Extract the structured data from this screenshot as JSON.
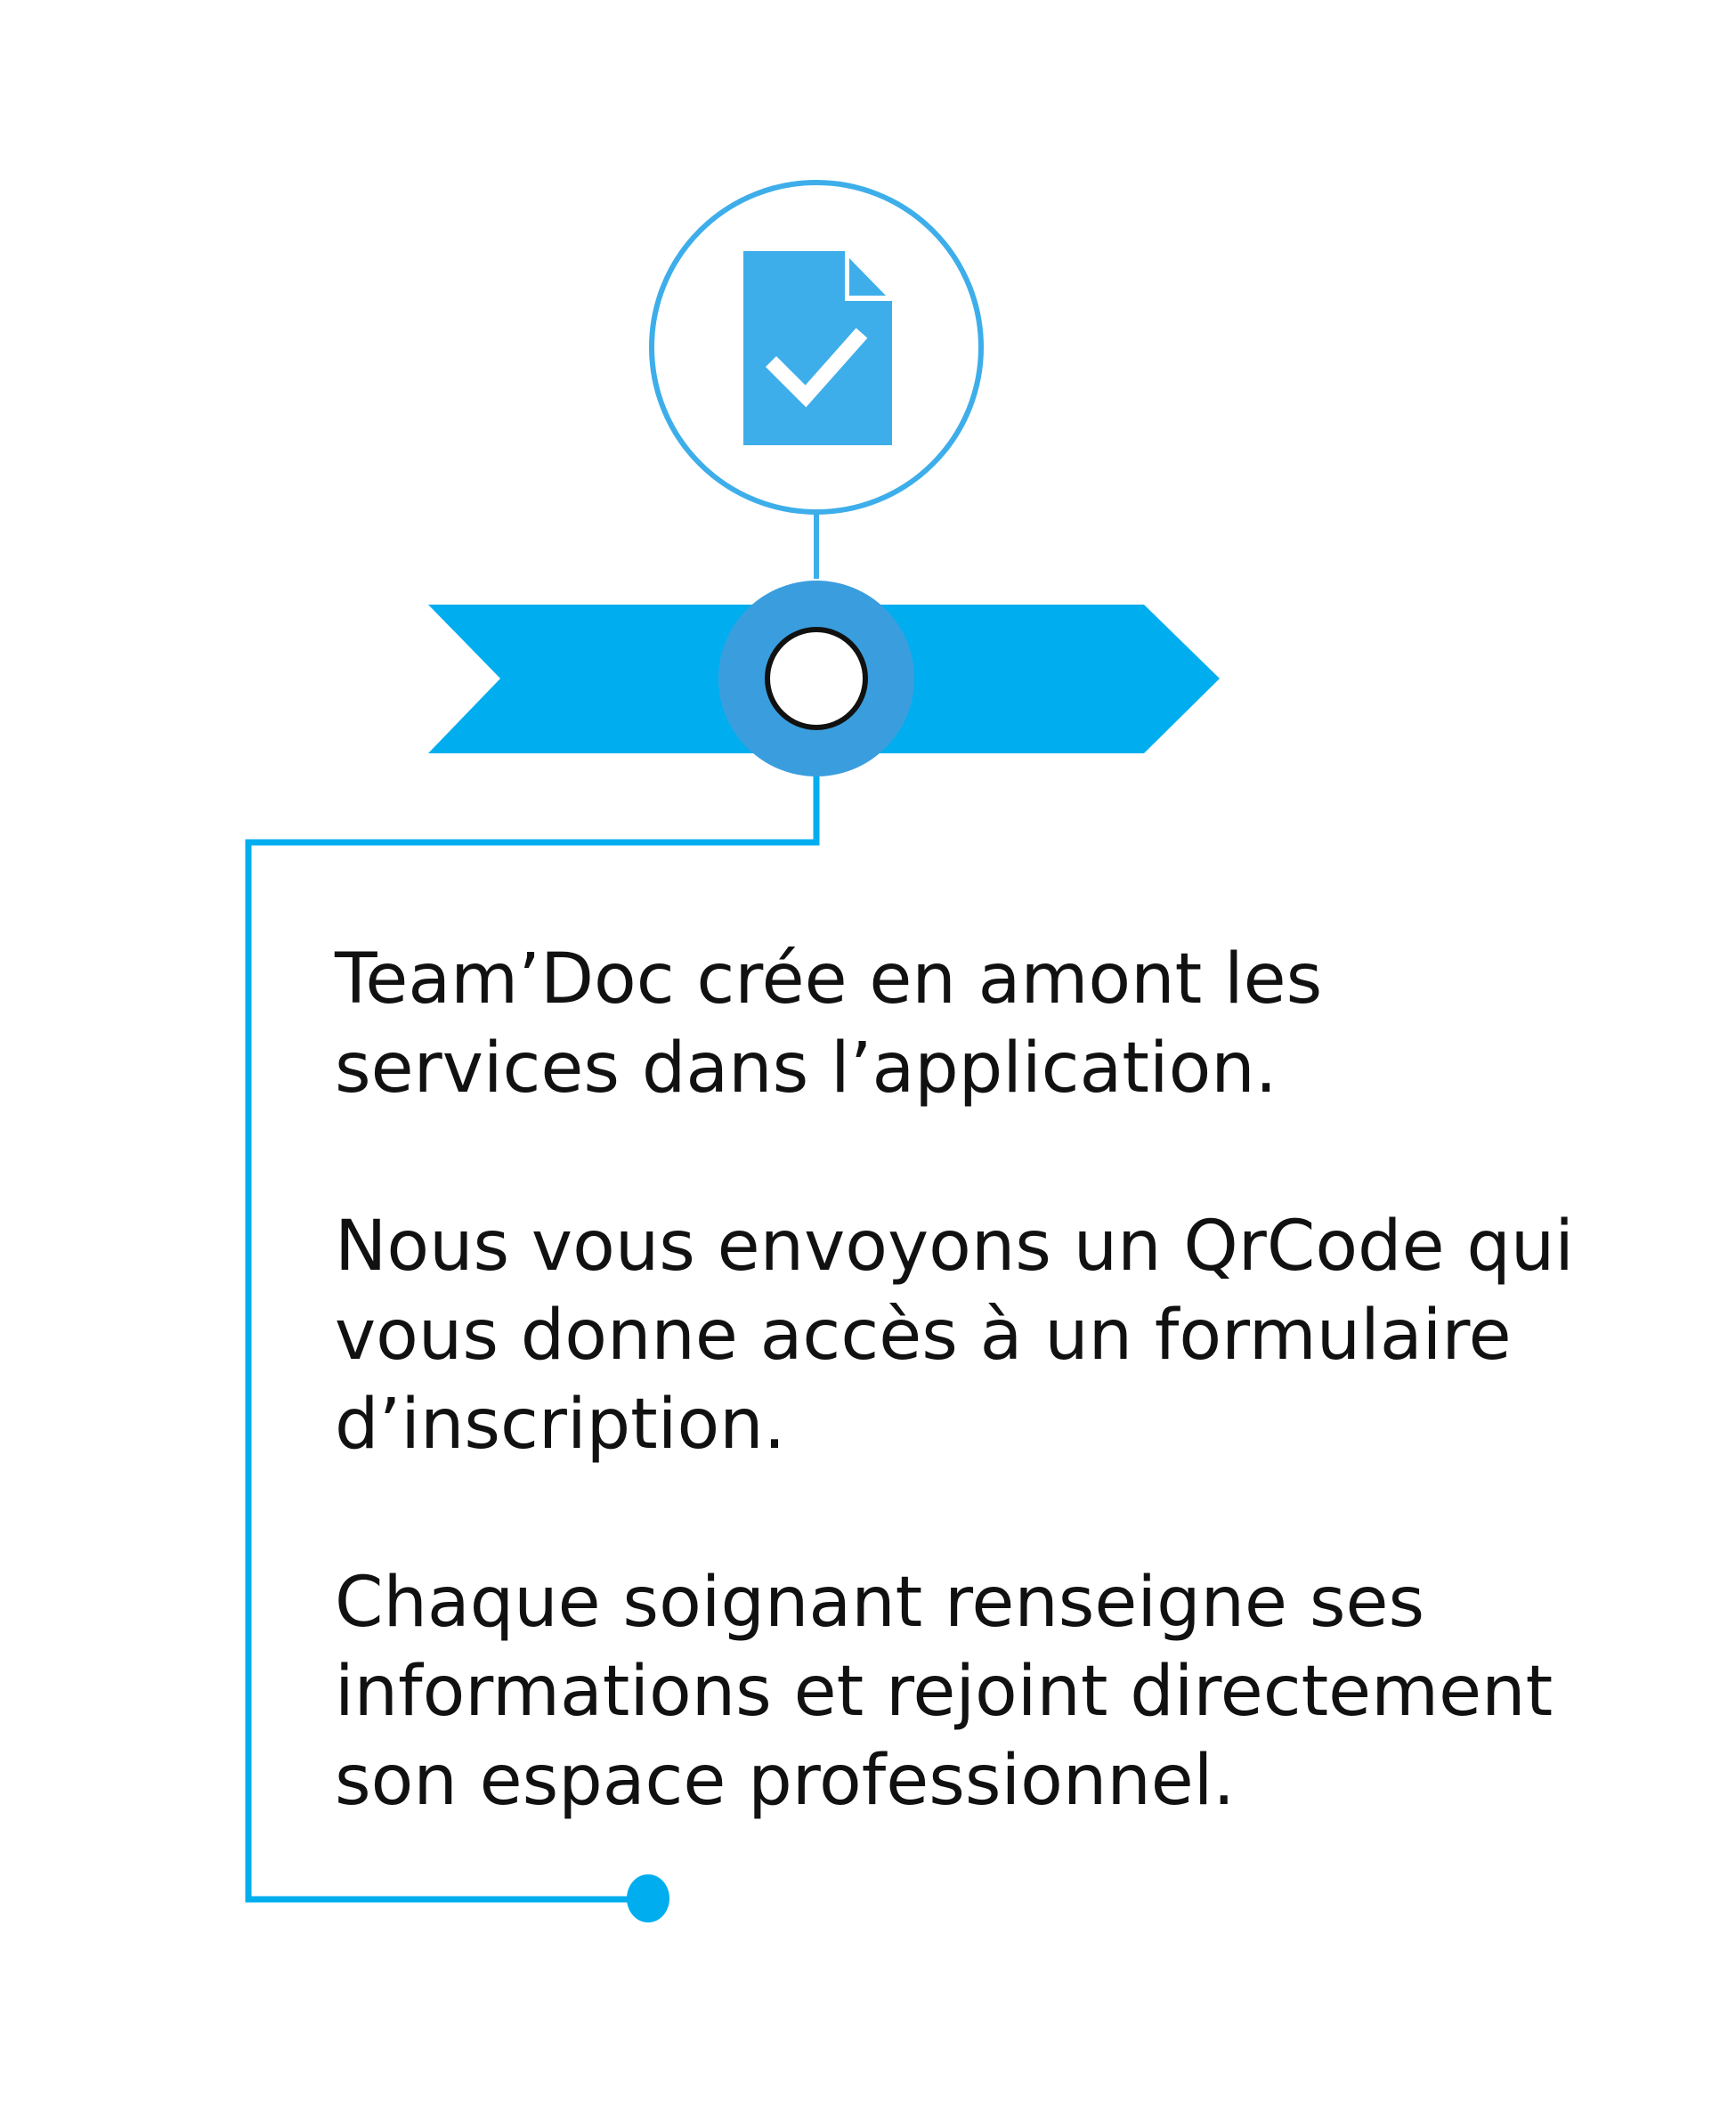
{
  "colors": {
    "accent": "#3daeea",
    "ribbon": "#00aeef",
    "hub": "#3a9ede",
    "text": "#111111",
    "background": "#ffffff"
  },
  "icon": {
    "name": "document-check-icon"
  },
  "paragraphs": [
    {
      "lines": [
        "Team’Doc crée en amont les",
        "services dans l’application."
      ]
    },
    {
      "lines": [
        "Nous vous envoyons un QrCode qui",
        "vous donne accès à un formulaire",
        "d’inscription."
      ]
    },
    {
      "lines": [
        "Chaque soignant renseigne ses",
        "informations et rejoint directement",
        "son espace professionnel."
      ]
    }
  ]
}
